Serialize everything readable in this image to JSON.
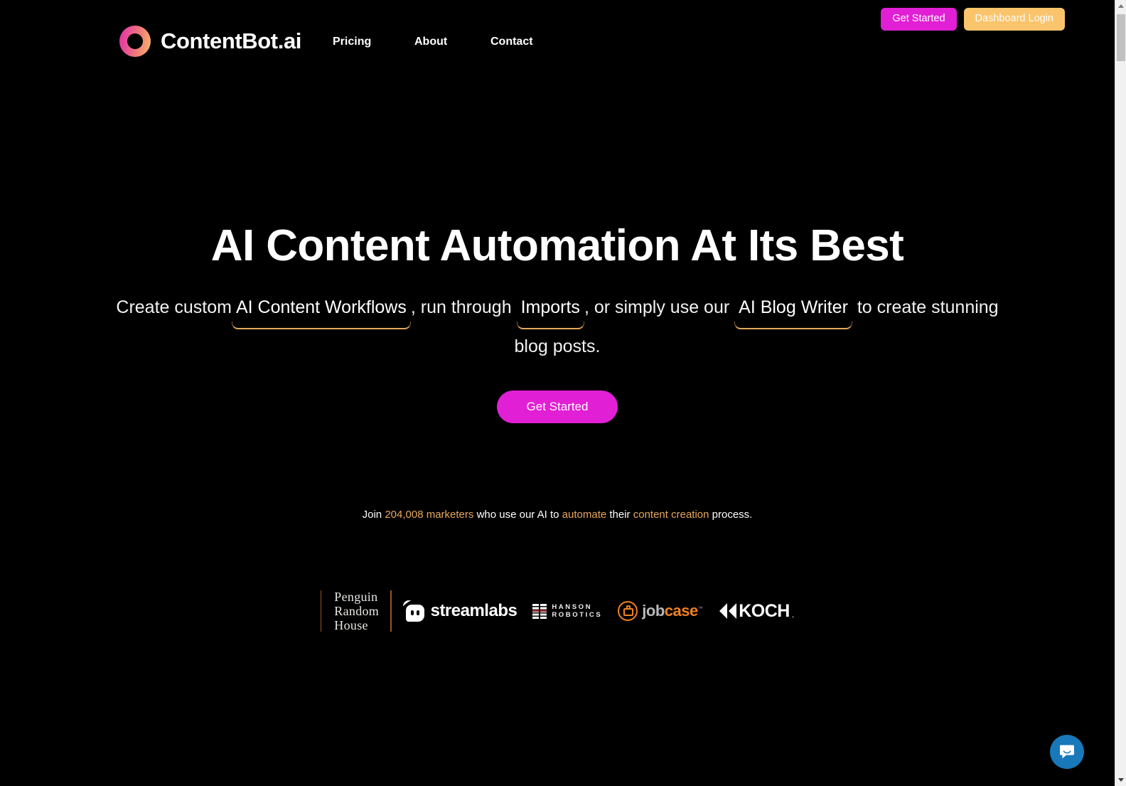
{
  "site": {
    "background": "#000000",
    "accent_magenta": "#e11fd4",
    "accent_orange": "#e8a85c",
    "logo_mark": "contentbot-ring-icon"
  },
  "header": {
    "brand_name": "ContentBot.ai",
    "nav": [
      {
        "label": "Pricing"
      },
      {
        "label": "About"
      },
      {
        "label": "Contact"
      }
    ],
    "actions": {
      "get_started_label": "Get Started",
      "dashboard_login_label": "Dashboard Login"
    }
  },
  "hero": {
    "title": "AI Content Automation At Its Best",
    "sub_part1": "Create custom",
    "link1": "AI Content Workflows",
    "sub_part2": ", run through",
    "link2": "Imports",
    "sub_part3": ", or simply use our",
    "link3": "AI Blog Writer",
    "sub_part4": "to create stunning blog posts.",
    "cta_label": "Get Started"
  },
  "social_proof": {
    "prefix": "Join",
    "count": "204,008 marketers",
    "middle": "who use our AI to",
    "verb": "automate",
    "middle2": "their",
    "noun": "content creation",
    "suffix": "process."
  },
  "logos": {
    "penguin_random_house": "Penguin\nRandom\nHouse",
    "streamlabs": "streamlabs",
    "hanson_robotics": "HANSON\nROBOTICS",
    "jobcase_job": "job",
    "jobcase_case": "case",
    "jobcase_tm": "™",
    "koch": "KOCH",
    "koch_dot": "."
  },
  "chat": {
    "launcher_icon": "chat-bubble-smile-icon"
  },
  "scrollbar": {
    "up_arrow": "scroll-up-arrow",
    "down_arrow": "scroll-down-arrow"
  }
}
